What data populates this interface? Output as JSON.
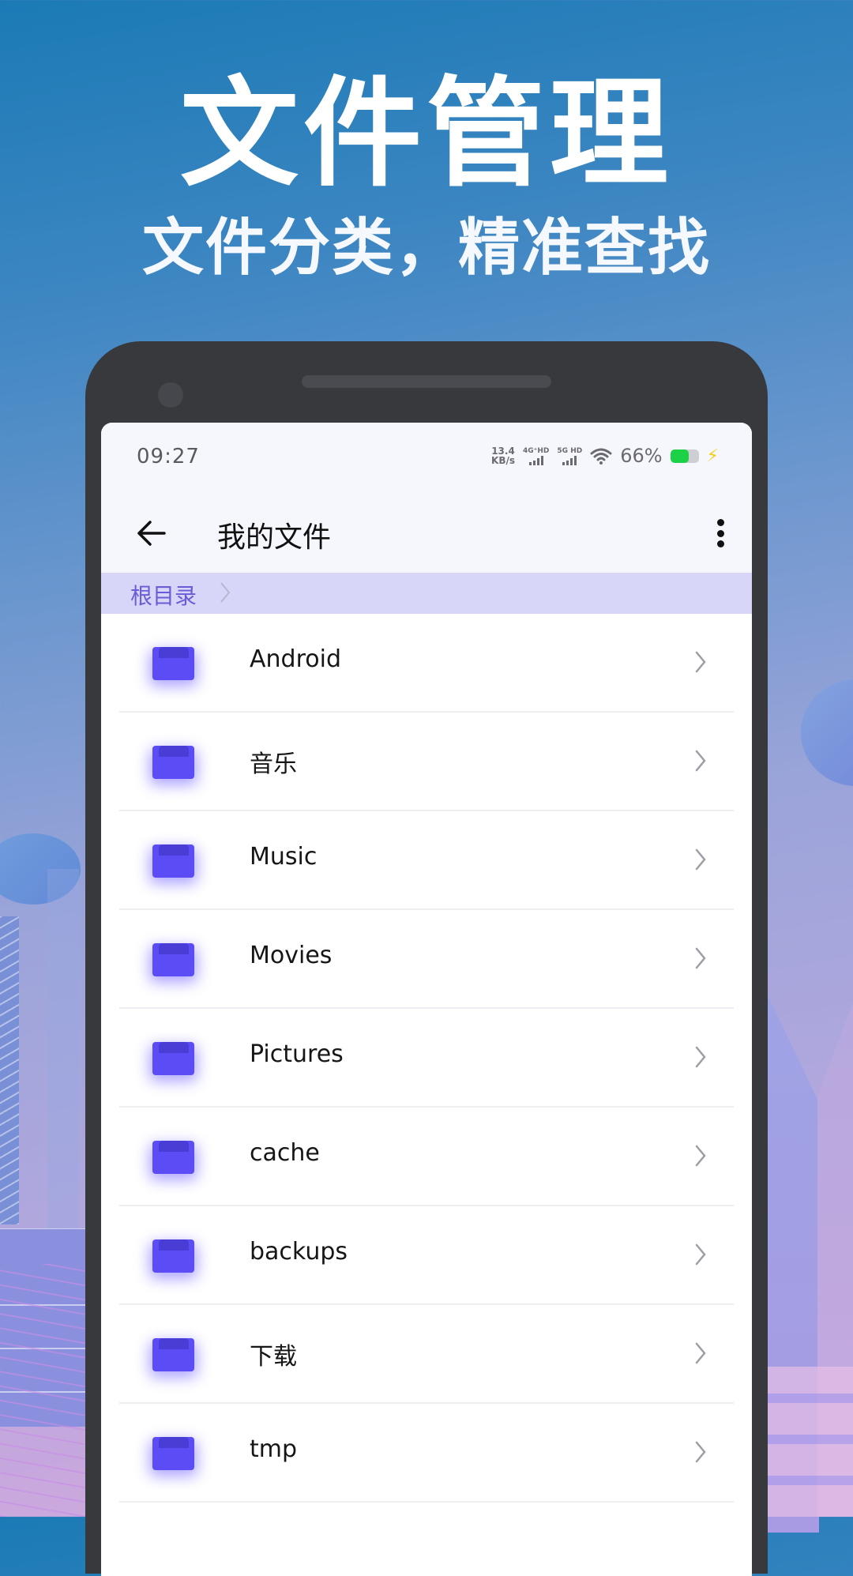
{
  "promo": {
    "headline": "文件管理",
    "subheadline": "文件分类，精准查找"
  },
  "status_bar": {
    "time": "09:27",
    "net_speed_value": "13.4",
    "net_speed_unit": "KB/s",
    "signal_1_label": "4G⁺HD",
    "signal_2_label": "5G HD",
    "wifi_icon": "wifi-icon",
    "battery_percent_text": "66%",
    "battery_level": 0.66,
    "charging_icon": "lightning-bolt-icon",
    "colors": {
      "battery": "#1bd146",
      "bolt": "#f2d016"
    }
  },
  "app_bar": {
    "back_icon": "arrow-left-icon",
    "title": "我的文件",
    "more_icon": "more-vertical-icon"
  },
  "breadcrumb": {
    "items": [
      "根目录"
    ],
    "separator_icon": "chevron-right-icon",
    "color": "#6a5cd8"
  },
  "files": {
    "folder_icon": "folder-icon",
    "folder_color": "#5b4cf5",
    "items": [
      {
        "name": "Android"
      },
      {
        "name": "音乐"
      },
      {
        "name": "Music"
      },
      {
        "name": "Movies"
      },
      {
        "name": "Pictures"
      },
      {
        "name": "cache"
      },
      {
        "name": "backups"
      },
      {
        "name": "下载"
      },
      {
        "name": "tmp"
      }
    ]
  }
}
